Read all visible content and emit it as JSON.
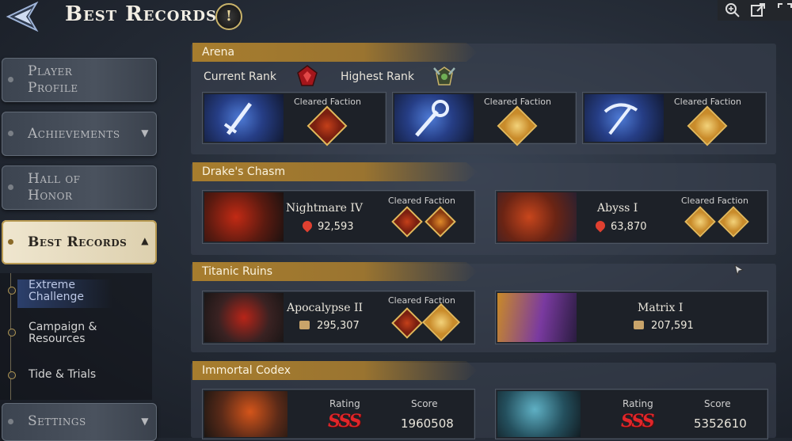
{
  "header": {
    "title": "Best Records",
    "info_glyph": "!"
  },
  "toolbar": {
    "icons": [
      "zoom-in-icon",
      "open-external-icon",
      "fullscreen-icon"
    ]
  },
  "sidebar": {
    "items": [
      {
        "label": "Player Profile",
        "line1": "Player",
        "line2": "Profile"
      },
      {
        "label": "Achievements"
      },
      {
        "label": "Hall of Honor",
        "line1": "Hall of",
        "line2": "Honor"
      },
      {
        "label": "Best Records",
        "selected": true
      },
      {
        "label": "Settings"
      }
    ],
    "subitems": [
      {
        "label": "Extreme Challenge",
        "line1": "Extreme",
        "line2": "Challenge",
        "selected": true
      },
      {
        "label": "Campaign & Resources",
        "line1": "Campaign &",
        "line2": "Resources"
      },
      {
        "label": "Tide & Trials"
      }
    ]
  },
  "arena": {
    "title": "Arena",
    "current_rank_label": "Current Rank",
    "highest_rank_label": "Highest Rank",
    "cards": [
      {
        "label": "Cleared Faction",
        "icon": "sword-icon"
      },
      {
        "label": "Cleared Faction",
        "icon": "mace-icon"
      },
      {
        "label": "Cleared Faction",
        "icon": "crossbow-icon"
      }
    ]
  },
  "drakes_chasm": {
    "title": "Drake's Chasm",
    "cards": [
      {
        "name": "Nightmare IV",
        "value": "92,593",
        "label": "Cleared Faction"
      },
      {
        "name": "Abyss I",
        "value": "63,870",
        "label": "Cleared Faction"
      }
    ]
  },
  "titanic_ruins": {
    "title": "Titanic Ruins",
    "cards": [
      {
        "name": "Apocalypse II",
        "value": "295,307",
        "label": "Cleared Faction"
      },
      {
        "name": "Matrix I",
        "value": "207,591"
      }
    ]
  },
  "immortal_codex": {
    "title": "Immortal Codex",
    "cards": [
      {
        "rating_label": "Rating",
        "rating": "SSS",
        "score_label": "Score",
        "score": "1960508"
      },
      {
        "rating_label": "Rating",
        "rating": "SSS",
        "score_label": "Score",
        "score": "5352610"
      }
    ]
  },
  "colors": {
    "accent_gold": "#a77d2e",
    "selected_tab": "#efe6cf",
    "rating_red": "#e0262a"
  }
}
